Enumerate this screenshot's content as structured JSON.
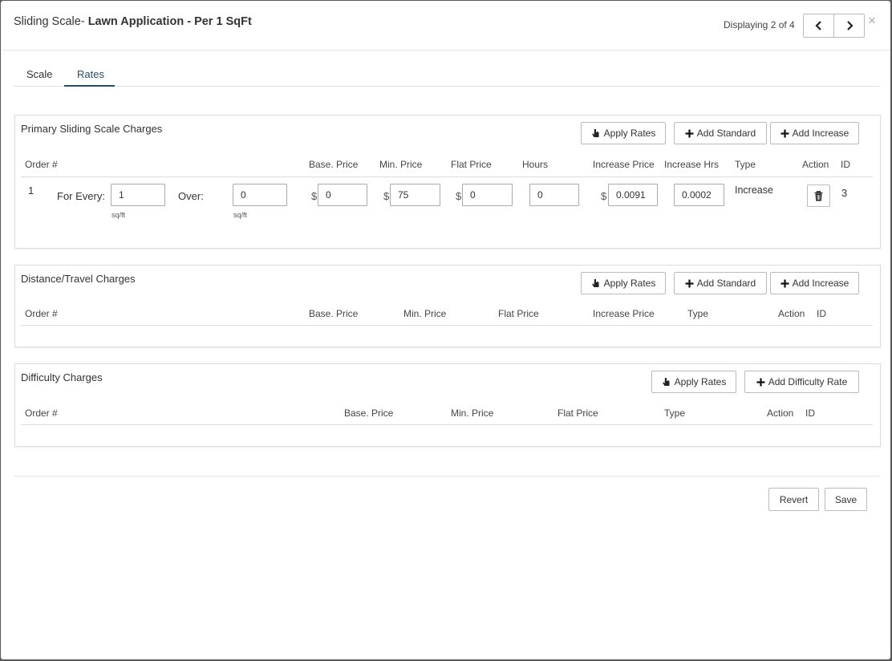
{
  "header": {
    "title_prefix": "Sliding Scale- ",
    "title_bold": "Lawn Application - Per 1 SqFt",
    "displaying": "Displaying 2 of 4",
    "close": "×"
  },
  "tabs": [
    {
      "label": "Scale",
      "active": false
    },
    {
      "label": "Rates",
      "active": true
    }
  ],
  "primary": {
    "title": "Primary Sliding Scale Charges",
    "buttons": {
      "apply": "Apply Rates",
      "add_standard": "Add Standard",
      "add_increase": "Add Increase"
    },
    "columns": [
      "Order #",
      "Base. Price",
      "Min. Price",
      "Flat Price",
      "Hours",
      "Increase Price",
      "Increase Hrs",
      "Type",
      "Action",
      "ID"
    ],
    "row": {
      "order": "1",
      "for_every_label": "For Every:",
      "for_every_value": "1",
      "for_every_unit": "sq/ft",
      "over_label": "Over:",
      "over_value": "0",
      "over_unit": "sq/ft",
      "currency": "$",
      "base_price": "0",
      "min_price": "75",
      "flat_price": "0",
      "hours": "0",
      "increase_price": "0.0091",
      "increase_hrs": "0.0002",
      "type": "Increase",
      "id": "3"
    }
  },
  "distance": {
    "title": "Distance/Travel Charges",
    "buttons": {
      "apply": "Apply Rates",
      "add_standard": "Add Standard",
      "add_increase": "Add Increase"
    },
    "columns": [
      "Order #",
      "Base. Price",
      "Min. Price",
      "Flat Price",
      "Increase Price",
      "Type",
      "Action",
      "ID"
    ]
  },
  "difficulty": {
    "title": "Difficulty Charges",
    "buttons": {
      "apply": "Apply Rates",
      "add_difficulty": "Add Difficulty Rate"
    },
    "columns": [
      "Order #",
      "Base. Price",
      "Min. Price",
      "Flat Price",
      "Type",
      "Action",
      "ID"
    ]
  },
  "footer": {
    "revert": "Revert",
    "save": "Save"
  },
  "colors": {
    "accent": "#2b4a64",
    "border": "#dddddd"
  }
}
